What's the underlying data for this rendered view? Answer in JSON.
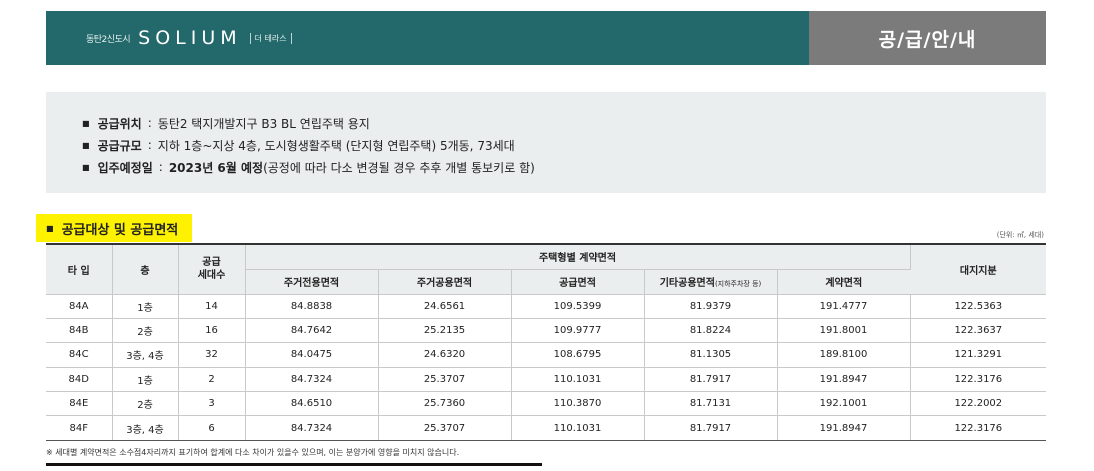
{
  "header": {
    "brand_sub": "동탄2신도시",
    "brand_logo": "SOLIUM",
    "brand_tag": "더 테라스",
    "section_label": "공/급/안/내"
  },
  "info": [
    {
      "label": "공급위치",
      "value": "동탄2 택지개발지구 B3 BL 연립주택 용지"
    },
    {
      "label": "공급규모",
      "value": "지하 1층~지상 4층, 도시형생활주택 (단지형 연립주택) 5개동, 73세대"
    },
    {
      "label": "입주예정일",
      "value_bold": "2023년 6월 예정",
      "value": "(공정에 따라 다소 변경될 경우 추후 개별 통보키로 함)"
    }
  ],
  "section_title": "공급대상 및 공급면적",
  "unit_note": "(단위: ㎡, 세대)",
  "table": {
    "headers": {
      "type": "타 입",
      "floor": "층",
      "units": "공급\n세대수",
      "contract_group": "주택형별 계약면적",
      "exclusive": "주거전용면적",
      "common": "주거공용면적",
      "supply": "공급면적",
      "other_common": "기타공용면적",
      "other_common_note": "(지하주차장 등)",
      "contract": "계약면적",
      "land": "대지지분"
    },
    "rows": [
      {
        "type": "84A",
        "floor": "1층",
        "units": "14",
        "exclusive": "84.8838",
        "common": "24.6561",
        "supply": "109.5399",
        "other": "81.9379",
        "contract": "191.4777",
        "land": "122.5363"
      },
      {
        "type": "84B",
        "floor": "2층",
        "units": "16",
        "exclusive": "84.7642",
        "common": "25.2135",
        "supply": "109.9777",
        "other": "81.8224",
        "contract": "191.8001",
        "land": "122.3637"
      },
      {
        "type": "84C",
        "floor": "3층, 4층",
        "units": "32",
        "exclusive": "84.0475",
        "common": "24.6320",
        "supply": "108.6795",
        "other": "81.1305",
        "contract": "189.8100",
        "land": "121.3291"
      },
      {
        "type": "84D",
        "floor": "1층",
        "units": "2",
        "exclusive": "84.7324",
        "common": "25.3707",
        "supply": "110.1031",
        "other": "81.7917",
        "contract": "191.8947",
        "land": "122.3176"
      },
      {
        "type": "84E",
        "floor": "2층",
        "units": "3",
        "exclusive": "84.6510",
        "common": "25.7360",
        "supply": "110.3870",
        "other": "81.7131",
        "contract": "192.1001",
        "land": "122.2002"
      },
      {
        "type": "84F",
        "floor": "3층, 4층",
        "units": "6",
        "exclusive": "84.7324",
        "common": "25.3707",
        "supply": "110.1031",
        "other": "81.7917",
        "contract": "191.8947",
        "land": "122.3176"
      }
    ]
  },
  "footnote": "※ 세대별 계약면적은 소수점4자리까지 표기하여 합계에 다소 차이가 있을수 있으며, 이는 분양가에 영향을 미치지 않습니다."
}
